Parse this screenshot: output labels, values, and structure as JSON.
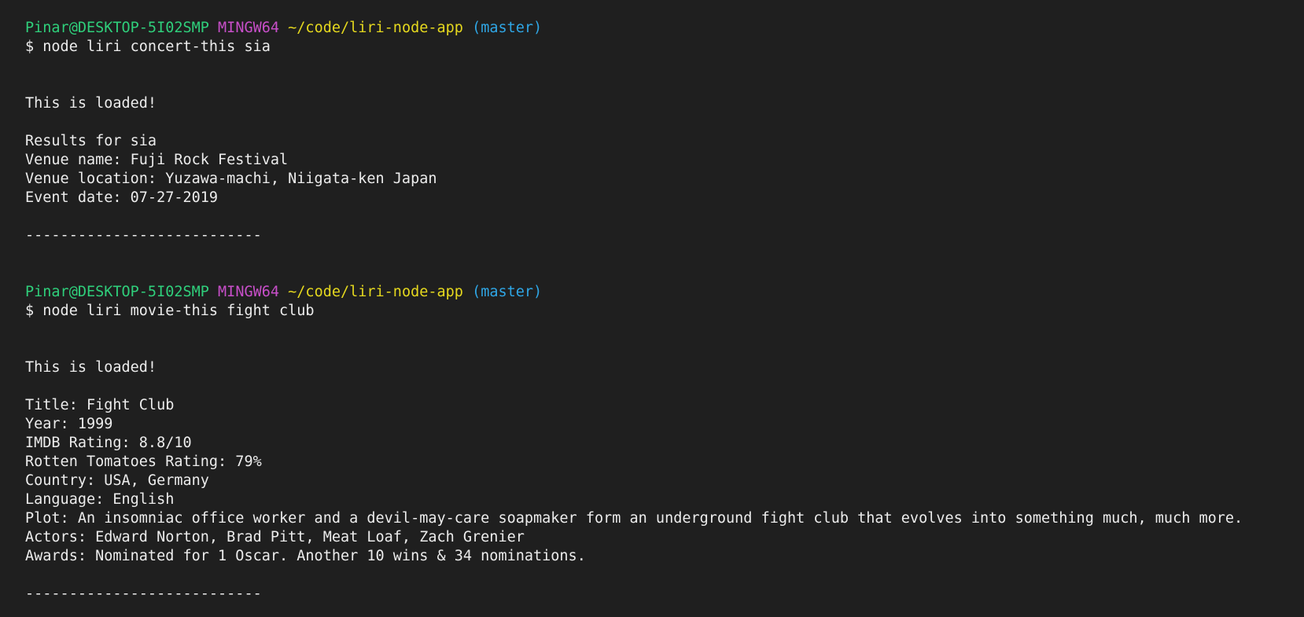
{
  "colors": {
    "background": "#1f1f1f",
    "text": "#ececec",
    "user_host": "#2fcf7b",
    "shell": "#c84fc9",
    "path": "#e5d81e",
    "branch": "#2fa6e5"
  },
  "sessions": [
    {
      "prompt": {
        "user_host": "Pinar@DESKTOP-5I02SMP",
        "shell": "MINGW64",
        "path": "~/code/liri-node-app",
        "branch": "(master)"
      },
      "command": "$ node liri concert-this sia",
      "loaded": "This is loaded!",
      "results": [
        "Results for sia",
        "Venue name: Fuji Rock Festival",
        "Venue location: Yuzawa-machi, Niigata-ken Japan",
        "Event date: 07-27-2019"
      ],
      "separator": "---------------------------"
    },
    {
      "prompt": {
        "user_host": "Pinar@DESKTOP-5I02SMP",
        "shell": "MINGW64",
        "path": "~/code/liri-node-app",
        "branch": "(master)"
      },
      "command": "$ node liri movie-this fight club",
      "loaded": "This is loaded!",
      "results": [
        "Title: Fight Club",
        "Year: 1999",
        "IMDB Rating: 8.8/10",
        "Rotten Tomatoes Rating: 79%",
        "Country: USA, Germany",
        "Language: English",
        "Plot: An insomniac office worker and a devil-may-care soapmaker form an underground fight club that evolves into something much, much more.",
        "Actors: Edward Norton, Brad Pitt, Meat Loaf, Zach Grenier",
        "Awards: Nominated for 1 Oscar. Another 10 wins & 34 nominations."
      ],
      "separator": "---------------------------"
    }
  ]
}
